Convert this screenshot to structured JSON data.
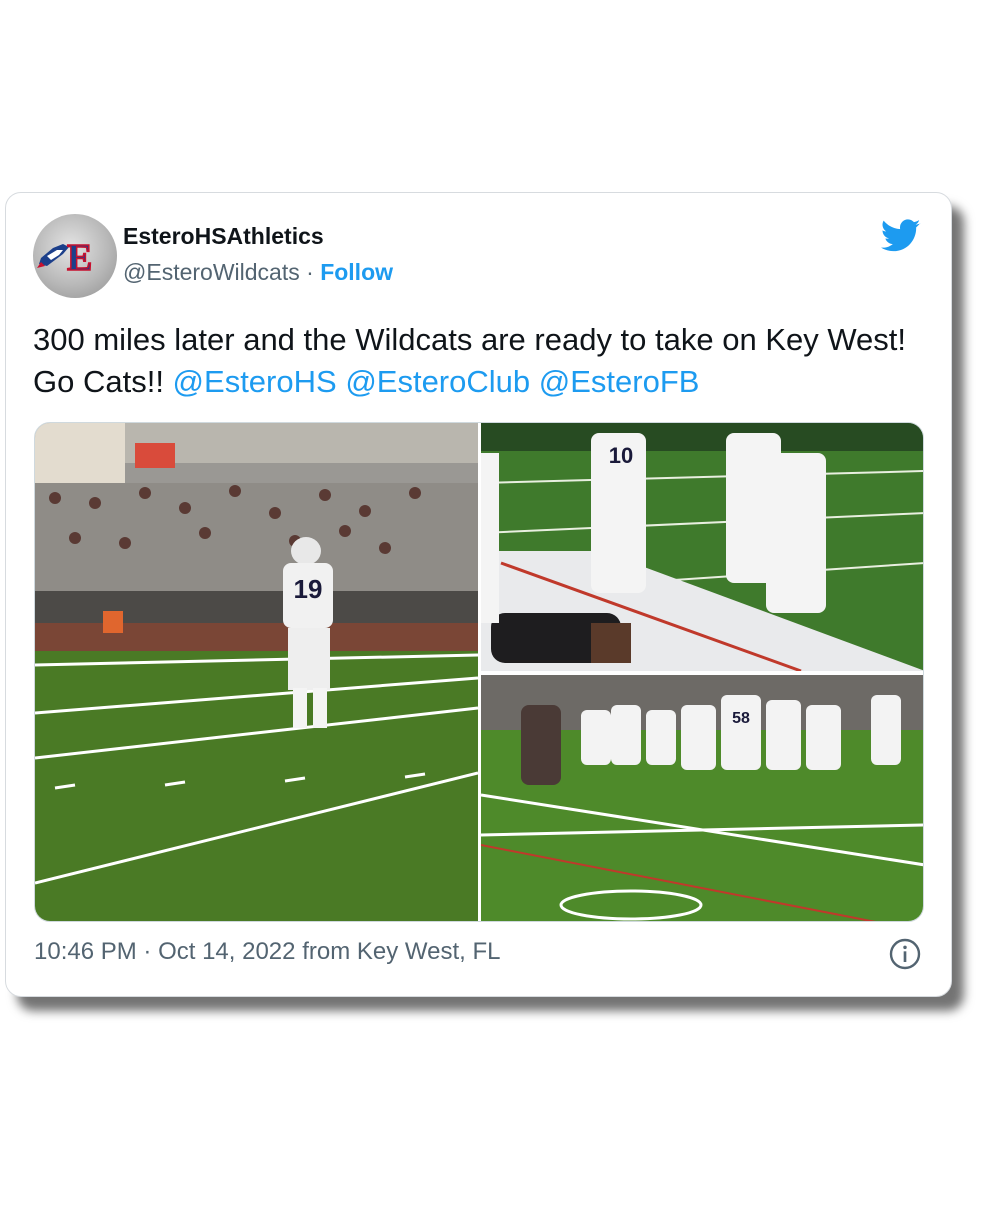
{
  "tweet": {
    "display_name": "EsteroHSAthletics",
    "handle": "@EsteroWildcats",
    "separator": "·",
    "follow_label": "Follow",
    "text_before": "300 miles later and the Wildcats are ready to take on Key West! Go Cats!! ",
    "mentions": [
      "@EsteroHS",
      "@EsteroClub",
      "@EsteroFB"
    ],
    "time": "10:46 PM",
    "date": "Oct 14, 2022",
    "location_text": "from Key West, FL"
  },
  "media": {
    "count": 3,
    "photos": [
      {
        "name": "photo-player-19",
        "jersey_number": "19"
      },
      {
        "name": "photo-sideline-warmup",
        "jersey_number": "10"
      },
      {
        "name": "photo-team-formation",
        "jersey_number": "58"
      }
    ]
  },
  "icons": {
    "logo": "twitter-bird-icon",
    "info": "info-icon",
    "avatar": "wildcat-e-logo"
  },
  "colors": {
    "accent": "#1d9bf0",
    "text_primary": "#0f1419",
    "text_secondary": "#536471",
    "border": "#d7dbdf"
  }
}
